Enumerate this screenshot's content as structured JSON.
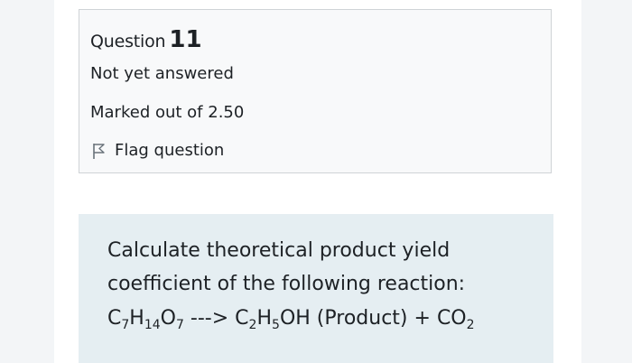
{
  "question_info": {
    "label": "Question",
    "number": "11",
    "status": "Not yet answered",
    "marks": "Marked out of 2.50",
    "flag_label": "Flag question"
  },
  "question_body": {
    "text": "Calculate theoretical product yield coefficient of the following reaction:",
    "equation": {
      "reactant": [
        {
          "t": "C"
        },
        {
          "t": "7",
          "sub": true
        },
        {
          "t": "H"
        },
        {
          "t": "14",
          "sub": true
        },
        {
          "t": "O"
        },
        {
          "t": "7",
          "sub": true
        }
      ],
      "arrow": "--->",
      "product": [
        {
          "t": "C"
        },
        {
          "t": "2",
          "sub": true
        },
        {
          "t": "H"
        },
        {
          "t": "5",
          "sub": true
        },
        {
          "t": "OH"
        }
      ],
      "product_note": "(Product)",
      "plus": "+",
      "byproduct": [
        {
          "t": "CO"
        },
        {
          "t": "2",
          "sub": true
        }
      ]
    }
  },
  "colors": {
    "info_card_bg": "#f8f9fa",
    "content_card_bg": "#e5eef2",
    "text": "#1d2125"
  },
  "icons": {
    "flag": "flag-outline-icon"
  }
}
